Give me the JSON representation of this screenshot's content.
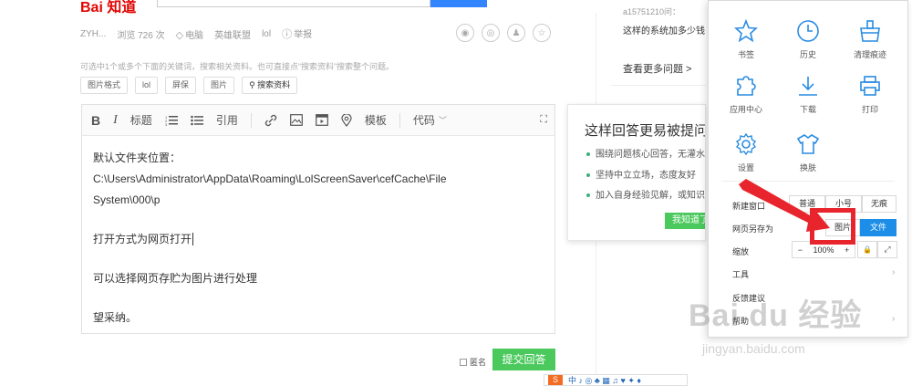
{
  "header": {
    "logo": "Bai 知道",
    "right_top_line1": "a15751210问：",
    "right_top_line2": "这样的系统加多少钱",
    "more_questions": "查看更多问题 >"
  },
  "meta": {
    "user": "ZYH...",
    "views": "浏览 726 次",
    "tag_icon_label": "电脑",
    "tag2": "英雄联盟",
    "tag3": "lol",
    "report": "举报"
  },
  "hint": "可选中1个或多个下面的关键词，搜索相关资料。也可直接点“搜索资料”搜索整个问题。",
  "keyword_tags": [
    "图片格式",
    "lol",
    "屏保",
    "图片"
  ],
  "search_tag": "搜索资料",
  "toolbar": {
    "bold": "B",
    "italic": "I",
    "heading": "标题",
    "quote": "引用",
    "template": "模板",
    "code": "代码"
  },
  "answer": {
    "line1": "默认文件夹位置：",
    "line2": "C:\\Users\\Administrator\\AppData\\Roaming\\LolScreenSaver\\cefCache\\File",
    "line3": "System\\000\\p",
    "line4": "打开方式为网页打开",
    "line5": "可以选择网页存贮为图片进行处理",
    "line6": "望采纳。"
  },
  "tip": {
    "title": "这样回答更易被提问",
    "items": [
      "围绕问题核心回答，无灌水",
      "坚持中立立场，态度友好",
      "加入自身经验见解，或知识"
    ],
    "button": "我知道了"
  },
  "footer": {
    "anonymous": "匿名",
    "submit": "提交回答"
  },
  "bottom_bar": {
    "logo": "S",
    "text": "中 ♪ ◎ ♣ ▦ ♫ ♥ ✦ ♦"
  },
  "menu": {
    "grid": [
      {
        "label": "书签",
        "icon": "star-icon"
      },
      {
        "label": "历史",
        "icon": "clock-icon"
      },
      {
        "label": "清理痕迹",
        "icon": "broom-icon"
      },
      {
        "label": "应用中心",
        "icon": "puzzle-icon"
      },
      {
        "label": "下载",
        "icon": "download-icon"
      },
      {
        "label": "打印",
        "icon": "printer-icon"
      },
      {
        "label": "设置",
        "icon": "gear-icon"
      },
      {
        "label": "换肤",
        "icon": "shirt-icon"
      }
    ],
    "new_window_label": "新建窗口",
    "new_window_options": [
      "普通",
      "小号",
      "无痕"
    ],
    "save_as_label": "网页另存为",
    "save_as_options": [
      "图片",
      "文件"
    ],
    "zoom_label": "缩放",
    "zoom_minus": "−",
    "zoom_value": "100%",
    "zoom_plus": "+",
    "zoom_lock": "🔒",
    "zoom_full": "⤢",
    "tools": "工具",
    "feedback": "反馈建议",
    "help": "帮助",
    "chevron": "›"
  },
  "watermark": {
    "main": "Bai du 经验",
    "sub": "jingyan.baidu.com"
  },
  "colors": {
    "accent_green": "#4bc95d",
    "menu_blue": "#1c8ee8",
    "icon_blue": "#2a8ce1",
    "highlight_red": "#e8252d"
  }
}
